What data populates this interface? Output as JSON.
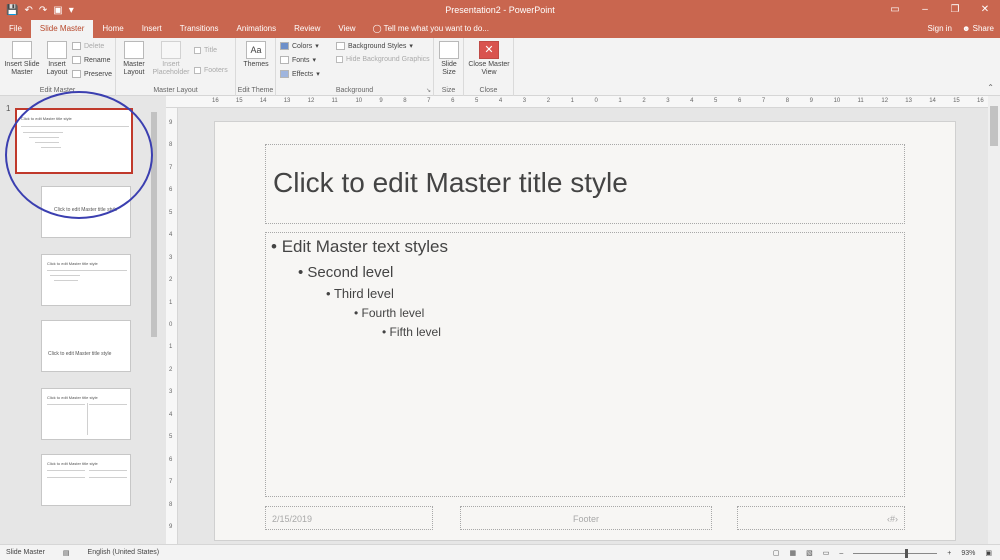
{
  "app": {
    "title": "Presentation2  -  PowerPoint"
  },
  "qat": {
    "save_icon": "save-icon",
    "undo_icon": "undo-icon",
    "redo_icon": "redo-icon",
    "present_icon": "present-icon",
    "customize_icon": "customize-icon"
  },
  "window": {
    "minimize": "–",
    "restore": "❐",
    "close": "✕",
    "ribbon_display": "▭"
  },
  "tabs": [
    "File",
    "Slide Master",
    "Home",
    "Insert",
    "Transitions",
    "Animations",
    "Review",
    "View"
  ],
  "tell_me": "Tell me what you want to do...",
  "sign_in": "Sign in",
  "share": "Share",
  "ribbon": {
    "edit_master": {
      "label": "Edit Master",
      "insert_slide_master": "Insert Slide Master",
      "insert_layout": "Insert Layout",
      "delete": "Delete",
      "rename": "Rename",
      "preserve": "Preserve"
    },
    "master_layout": {
      "label": "Master Layout",
      "master_layout_btn": "Master Layout",
      "insert_placeholder": "Insert Placeholder",
      "title": "Title",
      "footers": "Footers"
    },
    "edit_theme": {
      "label": "Edit Theme",
      "themes": "Themes"
    },
    "background": {
      "label": "Background",
      "colors": "Colors",
      "fonts": "Fonts",
      "effects": "Effects",
      "background_styles": "Background Styles",
      "hide_bg_graphics": "Hide Background Graphics"
    },
    "size": {
      "label": "Size",
      "slide_size": "Slide Size"
    },
    "close": {
      "label": "Close",
      "close_master_view": "Close Master View"
    }
  },
  "thumbnails": {
    "first_number": "1",
    "master_title": "Click to edit Master title style",
    "layout_title": "Click to edit Master title style"
  },
  "ruler": {
    "h_ticks": [
      "16",
      "15",
      "14",
      "13",
      "12",
      "11",
      "10",
      "9",
      "8",
      "7",
      "6",
      "5",
      "4",
      "3",
      "2",
      "1",
      "0",
      "1",
      "2",
      "3",
      "4",
      "5",
      "6",
      "7",
      "8",
      "9",
      "10",
      "11",
      "12",
      "13",
      "14",
      "15",
      "16"
    ],
    "v_ticks": [
      "9",
      "8",
      "7",
      "6",
      "5",
      "4",
      "3",
      "2",
      "1",
      "0",
      "1",
      "2",
      "3",
      "4",
      "5",
      "6",
      "7",
      "8",
      "9"
    ]
  },
  "slide": {
    "title": "Click to edit Master title style",
    "levels": [
      "Edit Master text styles",
      "Second level",
      "Third level",
      "Fourth level",
      "Fifth level"
    ],
    "date": "2/15/2019",
    "footer": "Footer",
    "slide_number": "‹#›"
  },
  "status": {
    "view": "Slide Master",
    "language": "English (United States)",
    "zoom": "93%",
    "zoom_level": 0.62
  },
  "colors": {
    "accent": "#c9664f",
    "selection": "#c0392b",
    "annotation_circle": "#3b3fb0"
  }
}
